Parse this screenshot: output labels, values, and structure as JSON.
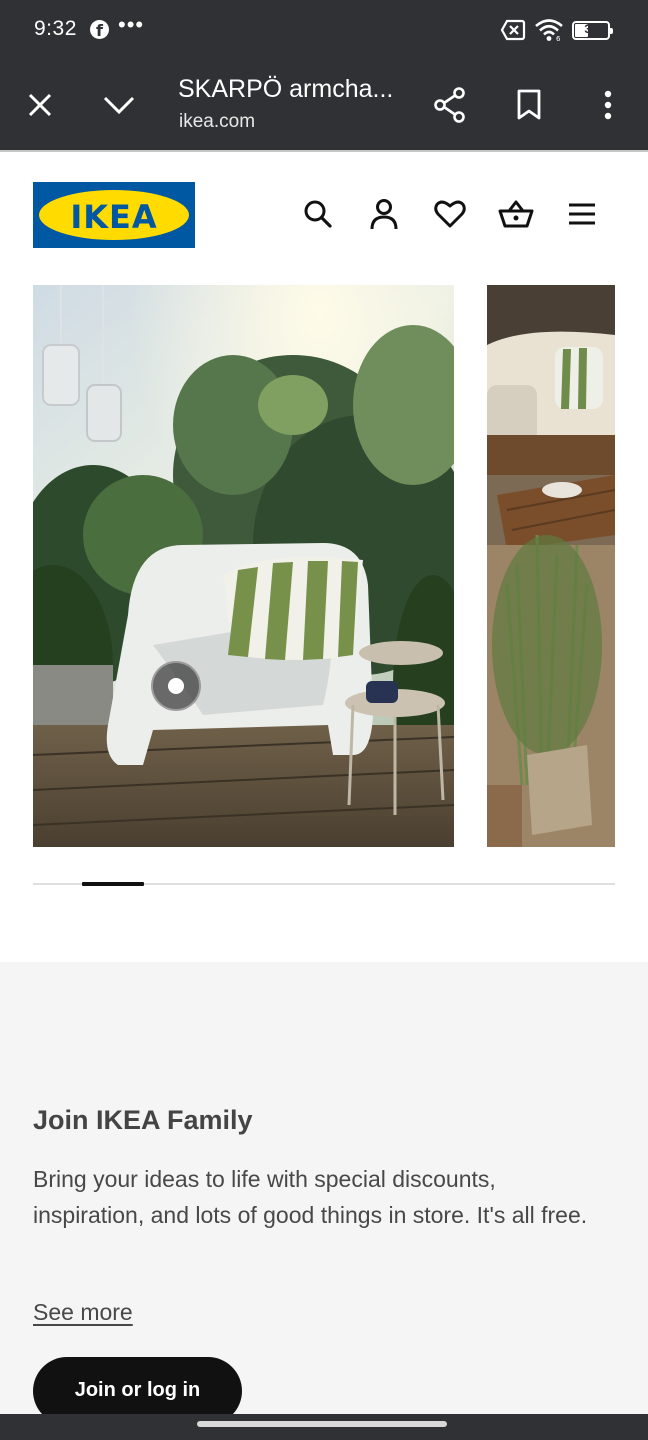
{
  "status_bar": {
    "time": "9:32",
    "app_icon": "facebook-icon",
    "overflow": "•••",
    "battery_level": "39",
    "icons": [
      "no-sim-icon",
      "wifi-icon",
      "battery-icon"
    ]
  },
  "browser": {
    "page_title": "SKARPÖ armcha...",
    "url": "ikea.com",
    "icons": [
      "close-icon",
      "chevron-down-icon",
      "share-icon",
      "bookmark-icon",
      "more-vert-icon"
    ]
  },
  "header": {
    "logo_text": "IKEA",
    "icons": [
      "search-icon",
      "account-icon",
      "favorites-icon",
      "basket-icon",
      "menu-icon"
    ],
    "colors": {
      "logo_blue": "#0058a3",
      "logo_yellow": "#ffdb00"
    }
  },
  "carousel": {
    "slides": [
      "white-armchair-plants",
      "outdoor-sofa-grass"
    ],
    "active_index": 0,
    "progress_fraction": 0.2
  },
  "family": {
    "title": "Join IKEA Family",
    "body": "Bring your ideas to life with special discounts, inspiration, and lots of good things in store. It's all free.",
    "link": "See more",
    "button": "Join or log in"
  }
}
